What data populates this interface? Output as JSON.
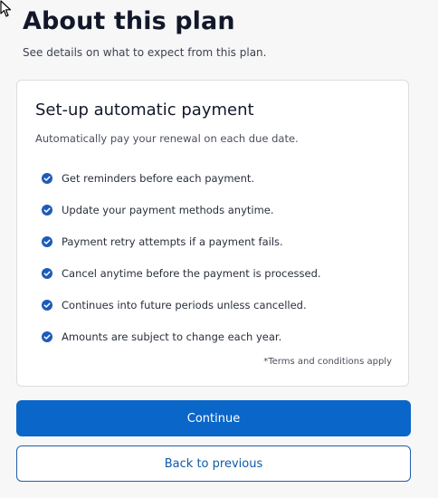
{
  "header": {
    "title": "About this plan",
    "subtitle": "See details on what to expect from this plan."
  },
  "card": {
    "title": "Set-up automatic payment",
    "description": "Automatically pay your renewal on each due date.",
    "features": [
      "Get reminders before each payment.",
      "Update your payment methods anytime.",
      "Payment retry attempts if a payment fails.",
      "Cancel anytime before the payment is processed.",
      "Continues into future periods unless cancelled.",
      "Amounts are subject to change each year."
    ],
    "terms": "*Terms and conditions apply"
  },
  "actions": {
    "continue_label": "Continue",
    "back_label": "Back to previous"
  },
  "icons": {
    "feature": "check-circle-icon",
    "cursor": "mouse-pointer-icon"
  },
  "colors": {
    "primary": "#0a66c8",
    "check": "#1e5bb8",
    "background": "#f7f7f8",
    "card": "#ffffff"
  }
}
